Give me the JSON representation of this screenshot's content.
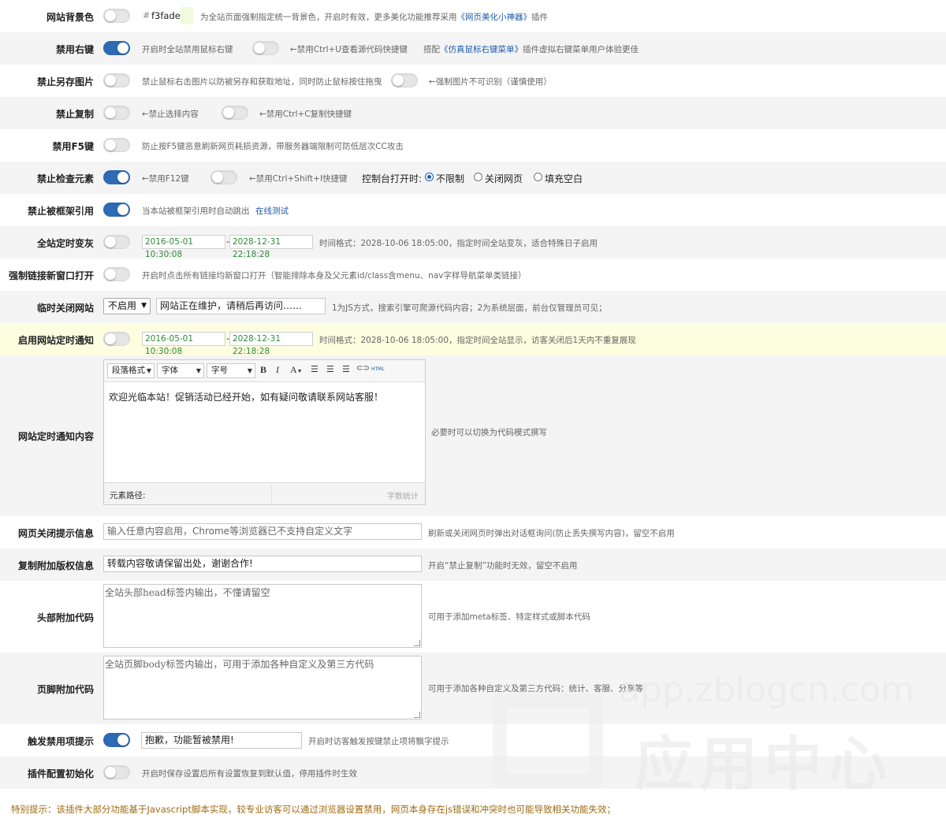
{
  "rows": {
    "bg_color": {
      "label": "网站背景色",
      "color_value": "f3fade",
      "hash": "#",
      "swatch_color": "#f3fade",
      "note_prefix": "为全站页面强制指定统一背景色，开启时有效，更多美化功能推荐采用",
      "note_link": "《网页美化小神器》",
      "note_suffix": "插件"
    },
    "right_click": {
      "label": "禁用右键",
      "note1": "开启时全站禁用鼠标右键",
      "note2": "←禁用Ctrl+U查看源代码快捷键",
      "note3_prefix": "搭配",
      "note3_link": "《仿真鼠标右键菜单》",
      "note3_suffix": "插件虚拟右键菜单用户体验更佳"
    },
    "save_image": {
      "label": "禁止另存图片",
      "note1": "禁止鼠标右击图片以防被另存和获取地址，同时防止鼠标按住拖曳",
      "note2": "←强制图片不可识别（谨慎使用）"
    },
    "copy": {
      "label": "禁止复制",
      "note1": "←禁止选择内容",
      "note2": "←禁用Ctrl+C复制快捷键"
    },
    "f5": {
      "label": "禁用F5键",
      "note": "防止按F5键恶意刷新网页耗损资源，带服务器端限制可防低层次CC攻击"
    },
    "inspect": {
      "label": "禁止检查元素",
      "note1": "←禁用F12键",
      "note2": "←禁用Ctrl+Shift+I快捷键",
      "console_label": "控制台打开时:",
      "options": [
        "不限制",
        "关闭网页",
        "填充空白"
      ]
    },
    "frame": {
      "label": "禁止被框架引用",
      "note": "当本站被框架引用时自动跳出",
      "link": "在线测试"
    },
    "gray": {
      "label": "全站定时变灰",
      "start": "2016-05-01 10:30:08",
      "dash": "-",
      "end": "2028-12-31 22:18:28",
      "note": "时间格式：2028-10-06 18:05:00，指定时间全站变灰，适合特殊日子启用"
    },
    "new_window": {
      "label": "强制链接新窗口打开",
      "note": "开启时点击所有链接均新窗口打开（智能排除本身及父元素id/class含menu、nav字样导航菜单类链接）"
    },
    "close_site": {
      "label": "临时关闭网站",
      "select_value": "不启用",
      "message": "网站正在维护，请稍后再访问……",
      "note": "1为JS方式，搜索引擎可爬源代码内容；2为系统层面，前台仅管理员可见；"
    },
    "timed_notice": {
      "label": "启用网站定时通知",
      "start": "2016-05-01 10:30:08",
      "dash": "-",
      "end": "2028-12-31 22:18:28",
      "note": "时间格式：2028-10-06 18:05:00，指定时间全站显示，访客关闭后1天内不重复展现"
    },
    "notice_content": {
      "label": "网站定时通知内容",
      "toolbar": {
        "paragraph": "段落格式",
        "font": "字体",
        "size": "字号",
        "bold": "B",
        "italic": "I",
        "color": "A",
        "html": "HTML"
      },
      "body": "欢迎光临本站！促销活动已经开始，如有疑问敬请联系网站客服！",
      "path_label": "元素路径:",
      "count_label": "字数统计",
      "note": "必要时可以切换为代码模式撰写"
    },
    "close_prompt": {
      "label": "网页关闭提示信息",
      "placeholder": "输入任意内容启用，Chrome等浏览器已不支持自定义文字",
      "note": "刷新或关闭网页时弹出对话框询问(防止丢失撰写内容)，留空不启用"
    },
    "copyright": {
      "label": "复制附加版权信息",
      "value": "转载内容敬请保留出处，谢谢合作!",
      "note": "开启“禁止复制”功能时无效，留空不启用"
    },
    "head_code": {
      "label": "头部附加代码",
      "placeholder": "全站头部head标签内输出，不懂请留空",
      "note": "可用于添加meta标签、特定样式或脚本代码"
    },
    "foot_code": {
      "label": "页脚附加代码",
      "placeholder": "全站页脚body标签内输出，可用于添加各种自定义及第三方代码",
      "note": "可用于添加各种自定义及第三方代码：统计、客服、分享等"
    },
    "trigger_tip": {
      "label": "触发禁用项提示",
      "value": "抱歉，功能暂被禁用!",
      "note": "开启时访客触发按键禁止项将飘字提示"
    },
    "reset": {
      "label": "插件配置初始化",
      "note": "开启时保存设置后所有设置恢复到默认值，停用插件时生效"
    }
  },
  "footer_tip": "特别提示：该插件大部分功能基于Javascript脚本实现，较专业访客可以通过浏览器设置禁用，网页本身存在js错误和冲突时也可能导致相关功能失效；",
  "watermark": {
    "domain": "app.zblogcn.com",
    "title": "应用中心"
  },
  "colors": {
    "toggle_on": "#2e6bb5",
    "link": "#1e5aa8",
    "date_text": "#2e8b3a",
    "tip": "#a06a12",
    "highlight_row": "#fdfde0"
  }
}
